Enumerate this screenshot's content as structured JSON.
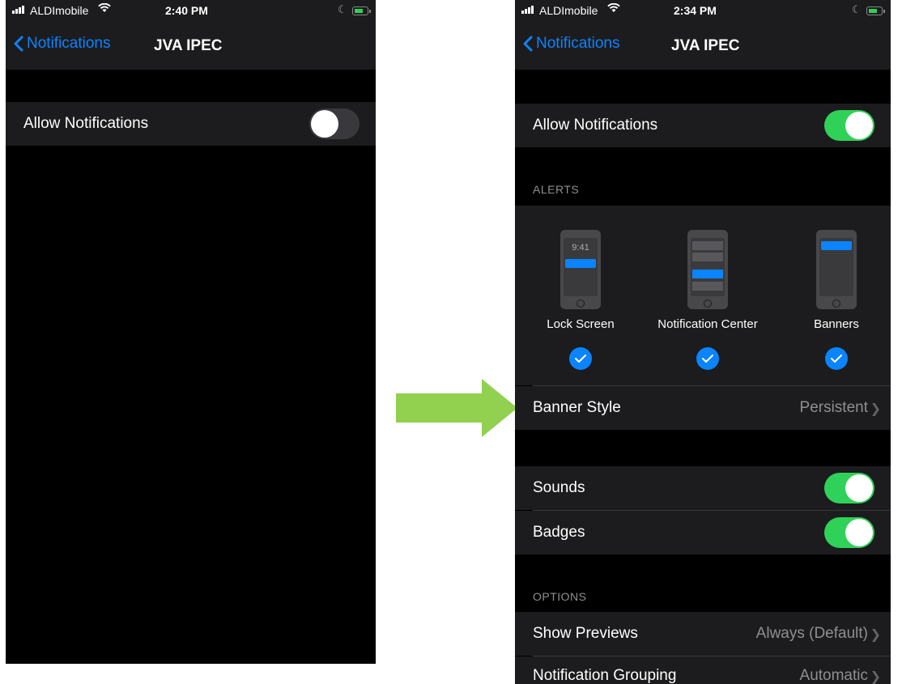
{
  "left_screen": {
    "status": {
      "carrier": "ALDImobile",
      "time": "2:40 PM"
    },
    "nav": {
      "back_label": "Notifications",
      "title": "JVA IPEC"
    },
    "allow_notifications": {
      "label": "Allow Notifications",
      "enabled": false
    }
  },
  "right_screen": {
    "status": {
      "carrier": "ALDImobile",
      "time": "2:34 PM"
    },
    "nav": {
      "back_label": "Notifications",
      "title": "JVA IPEC"
    },
    "allow_notifications": {
      "label": "Allow Notifications",
      "enabled": true
    },
    "alerts_header": "ALERTS",
    "alert_options": [
      {
        "label": "Lock Screen",
        "checked": true,
        "preview_time": "9:41",
        "icon": "lock-screen-preview-icon"
      },
      {
        "label": "Notification Center",
        "checked": true,
        "icon": "notification-center-preview-icon"
      },
      {
        "label": "Banners",
        "checked": true,
        "icon": "banners-preview-icon"
      }
    ],
    "banner_style": {
      "label": "Banner Style",
      "value": "Persistent"
    },
    "sounds": {
      "label": "Sounds",
      "enabled": true
    },
    "badges": {
      "label": "Badges",
      "enabled": true
    },
    "options_header": "OPTIONS",
    "show_previews": {
      "label": "Show Previews",
      "value": "Always (Default)"
    },
    "notification_grouping": {
      "label": "Notification Grouping",
      "value": "Automatic"
    }
  },
  "colors": {
    "accent_blue": "#0a84ff",
    "toggle_on": "#30d158",
    "arrow_green": "#92d050",
    "cell_bg": "#1c1c1e",
    "secondary_text": "#8e8e93"
  },
  "icons": {
    "signal": "signal-bars-icon",
    "wifi": "wifi-icon",
    "do_not_disturb": "moon-icon",
    "battery": "battery-charging-icon",
    "back": "chevron-left-icon",
    "disclosure": "chevron-right-icon",
    "check": "checkmark-circle-icon",
    "annotation": "right-arrow-icon"
  }
}
